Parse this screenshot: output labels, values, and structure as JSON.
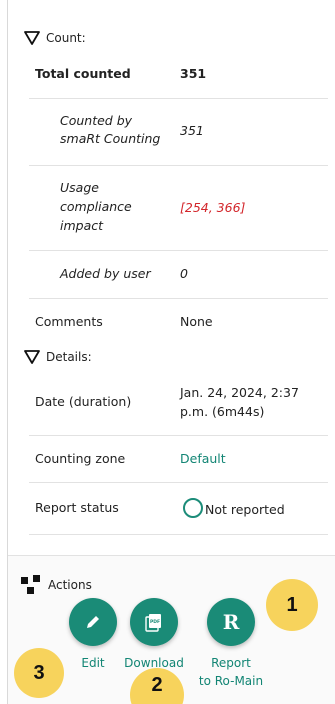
{
  "count_section": {
    "title": "Count:",
    "total_label": "Total counted",
    "total_value": "351",
    "counted_by_label_line1": "Counted by",
    "counted_by_label_line2": "smaRt Counting",
    "counted_by_value": "351",
    "usage_label_line1": "Usage",
    "usage_label_line2": "compliance",
    "usage_label_line3": "impact",
    "usage_value": "[254, 366]",
    "added_label": "Added by user",
    "added_value": "0",
    "comments_label": "Comments",
    "comments_value": "None"
  },
  "details_section": {
    "title": "Details:",
    "date_label": "Date (duration)",
    "date_value_line1": "Jan. 24, 2024, 2:37",
    "date_value_line2": "p.m. (6m44s)",
    "zone_label": "Counting zone",
    "zone_value": "Default",
    "status_label": "Report status",
    "status_value": "Not reported"
  },
  "actions": {
    "title": "Actions",
    "edit_label": "Edit",
    "download_label": "Download",
    "report_label_line1": "Report",
    "report_label_line2": "to Ro-Main"
  },
  "annotations": {
    "badge_1": "1",
    "badge_2": "2",
    "badge_3": "3"
  },
  "colors": {
    "accent": "#1a8b77",
    "link": "#128574",
    "warning_text": "#d3262b",
    "badge": "#f7d35c"
  },
  "icons": {
    "count_toggle": "triangle-down-icon",
    "details_toggle": "triangle-down-icon",
    "actions": "actions-cross-icon",
    "edit": "pencil-icon",
    "download": "pdf-icon",
    "report": "ro-main-r-icon",
    "status": "empty-circle-icon"
  }
}
